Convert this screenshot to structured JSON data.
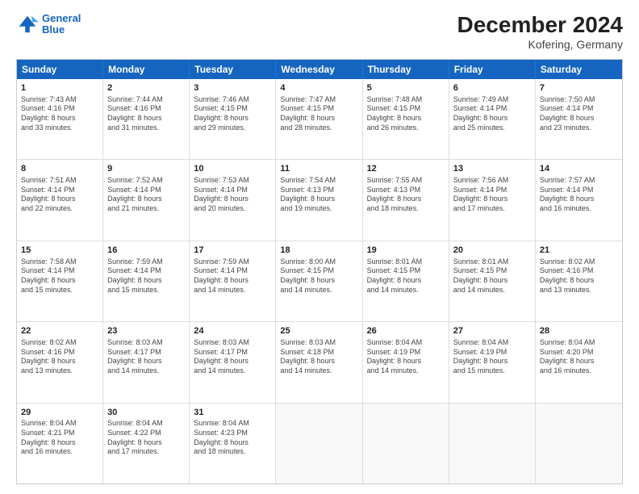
{
  "header": {
    "logo_line1": "General",
    "logo_line2": "Blue",
    "main_title": "December 2024",
    "sub_title": "Kofering, Germany"
  },
  "calendar": {
    "days": [
      "Sunday",
      "Monday",
      "Tuesday",
      "Wednesday",
      "Thursday",
      "Friday",
      "Saturday"
    ],
    "rows": [
      [
        {
          "day": "1",
          "rise": "7:43 AM",
          "set": "4:16 PM",
          "daylight": "8 hours",
          "minutes": "33"
        },
        {
          "day": "2",
          "rise": "7:44 AM",
          "set": "4:16 PM",
          "daylight": "8 hours",
          "minutes": "31"
        },
        {
          "day": "3",
          "rise": "7:46 AM",
          "set": "4:15 PM",
          "daylight": "8 hours",
          "minutes": "29"
        },
        {
          "day": "4",
          "rise": "7:47 AM",
          "set": "4:15 PM",
          "daylight": "8 hours",
          "minutes": "28"
        },
        {
          "day": "5",
          "rise": "7:48 AM",
          "set": "4:15 PM",
          "daylight": "8 hours",
          "minutes": "26"
        },
        {
          "day": "6",
          "rise": "7:49 AM",
          "set": "4:14 PM",
          "daylight": "8 hours",
          "minutes": "25"
        },
        {
          "day": "7",
          "rise": "7:50 AM",
          "set": "4:14 PM",
          "daylight": "8 hours",
          "minutes": "23"
        }
      ],
      [
        {
          "day": "8",
          "rise": "7:51 AM",
          "set": "4:14 PM",
          "daylight": "8 hours",
          "minutes": "22"
        },
        {
          "day": "9",
          "rise": "7:52 AM",
          "set": "4:14 PM",
          "daylight": "8 hours",
          "minutes": "21"
        },
        {
          "day": "10",
          "rise": "7:53 AM",
          "set": "4:14 PM",
          "daylight": "8 hours",
          "minutes": "20"
        },
        {
          "day": "11",
          "rise": "7:54 AM",
          "set": "4:13 PM",
          "daylight": "8 hours",
          "minutes": "19"
        },
        {
          "day": "12",
          "rise": "7:55 AM",
          "set": "4:13 PM",
          "daylight": "8 hours",
          "minutes": "18"
        },
        {
          "day": "13",
          "rise": "7:56 AM",
          "set": "4:14 PM",
          "daylight": "8 hours",
          "minutes": "17"
        },
        {
          "day": "14",
          "rise": "7:57 AM",
          "set": "4:14 PM",
          "daylight": "8 hours",
          "minutes": "16"
        }
      ],
      [
        {
          "day": "15",
          "rise": "7:58 AM",
          "set": "4:14 PM",
          "daylight": "8 hours",
          "minutes": "15"
        },
        {
          "day": "16",
          "rise": "7:59 AM",
          "set": "4:14 PM",
          "daylight": "8 hours",
          "minutes": "15"
        },
        {
          "day": "17",
          "rise": "7:59 AM",
          "set": "4:14 PM",
          "daylight": "8 hours",
          "minutes": "14"
        },
        {
          "day": "18",
          "rise": "8:00 AM",
          "set": "4:15 PM",
          "daylight": "8 hours",
          "minutes": "14"
        },
        {
          "day": "19",
          "rise": "8:01 AM",
          "set": "4:15 PM",
          "daylight": "8 hours",
          "minutes": "14"
        },
        {
          "day": "20",
          "rise": "8:01 AM",
          "set": "4:15 PM",
          "daylight": "8 hours",
          "minutes": "14"
        },
        {
          "day": "21",
          "rise": "8:02 AM",
          "set": "4:16 PM",
          "daylight": "8 hours",
          "minutes": "13"
        }
      ],
      [
        {
          "day": "22",
          "rise": "8:02 AM",
          "set": "4:16 PM",
          "daylight": "8 hours",
          "minutes": "13"
        },
        {
          "day": "23",
          "rise": "8:03 AM",
          "set": "4:17 PM",
          "daylight": "8 hours",
          "minutes": "14"
        },
        {
          "day": "24",
          "rise": "8:03 AM",
          "set": "4:17 PM",
          "daylight": "8 hours",
          "minutes": "14"
        },
        {
          "day": "25",
          "rise": "8:03 AM",
          "set": "4:18 PM",
          "daylight": "8 hours",
          "minutes": "14"
        },
        {
          "day": "26",
          "rise": "8:04 AM",
          "set": "4:19 PM",
          "daylight": "8 hours",
          "minutes": "14"
        },
        {
          "day": "27",
          "rise": "8:04 AM",
          "set": "4:19 PM",
          "daylight": "8 hours",
          "minutes": "15"
        },
        {
          "day": "28",
          "rise": "8:04 AM",
          "set": "4:20 PM",
          "daylight": "8 hours",
          "minutes": "16"
        }
      ],
      [
        {
          "day": "29",
          "rise": "8:04 AM",
          "set": "4:21 PM",
          "daylight": "8 hours",
          "minutes": "16"
        },
        {
          "day": "30",
          "rise": "8:04 AM",
          "set": "4:22 PM",
          "daylight": "8 hours",
          "minutes": "17"
        },
        {
          "day": "31",
          "rise": "8:04 AM",
          "set": "4:23 PM",
          "daylight": "8 hours",
          "minutes": "18"
        },
        null,
        null,
        null,
        null
      ]
    ]
  }
}
